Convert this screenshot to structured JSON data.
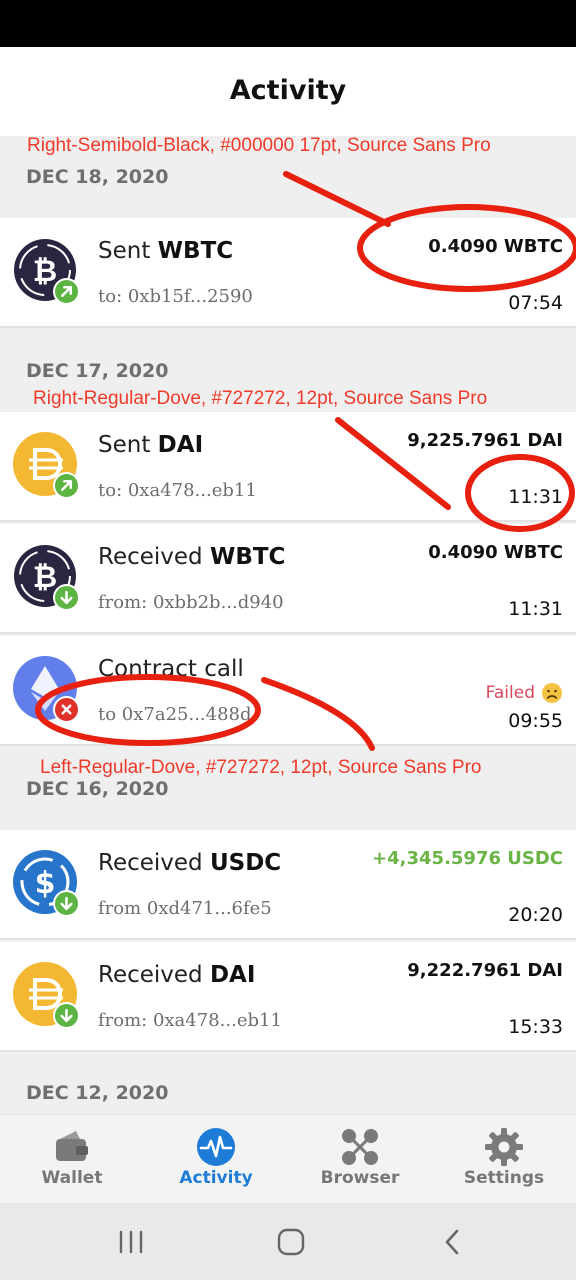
{
  "header": {
    "title": "Activity"
  },
  "sections": [
    {
      "date": "DEC 18, 2020"
    },
    {
      "date": "DEC 17, 2020"
    },
    {
      "date": "DEC 16, 2020"
    },
    {
      "date": "DEC 12, 2020"
    }
  ],
  "transactions": [
    {
      "verb": "Sent",
      "token": "WBTC",
      "address": "to: 0xb15f...2590",
      "amount": "0.4090 WBTC",
      "time": "07:54",
      "coin_icon": "wbtc-icon",
      "direction_icon": "sent-arrow-icon"
    },
    {
      "verb": "Sent",
      "token": "DAI",
      "address": "to: 0xa478...eb11",
      "amount": "9,225.7961 DAI",
      "time": "11:31",
      "coin_icon": "dai-icon",
      "direction_icon": "sent-arrow-icon"
    },
    {
      "verb": "Received",
      "token": "WBTC",
      "address": "from: 0xbb2b...d940",
      "amount": "0.4090 WBTC",
      "time": "11:31",
      "coin_icon": "wbtc-icon",
      "direction_icon": "received-arrow-icon"
    },
    {
      "verb": "Contract call",
      "token": "",
      "address": "to 0x7a25...488d",
      "status": "Failed",
      "time": "09:55",
      "coin_icon": "eth-icon",
      "direction_icon": "failed-x-icon"
    },
    {
      "verb": "Received",
      "token": "USDC",
      "address": "from 0xd471...6fe5",
      "amount": "+4,345.5976 USDC",
      "time": "20:20",
      "coin_icon": "usdc-icon",
      "direction_icon": "received-arrow-icon"
    },
    {
      "verb": "Received",
      "token": "DAI",
      "address": "from: 0xa478...eb11",
      "amount": "9,222.7961 DAI",
      "time": "15:33",
      "coin_icon": "dai-icon",
      "direction_icon": "received-arrow-icon"
    }
  ],
  "annotations": [
    "Right-Semibold-Black, #000000 17pt, Source Sans Pro",
    "Right-Regular-Dove, #727272, 12pt, Source Sans Pro",
    "Left-Regular-Dove, #727272, 12pt, Source Sans Pro"
  ],
  "tabs": [
    {
      "label": "Wallet",
      "icon": "wallet-icon",
      "active": false
    },
    {
      "label": "Activity",
      "icon": "activity-icon",
      "active": true
    },
    {
      "label": "Browser",
      "icon": "browser-icon",
      "active": false
    },
    {
      "label": "Settings",
      "icon": "gear-icon",
      "active": false
    }
  ],
  "colors": {
    "accent": "#1e7bd6",
    "received_amount": "#6ab446",
    "failed": "#d9485f",
    "annotation": "#f03a2a",
    "secondary_text": "#727272"
  }
}
